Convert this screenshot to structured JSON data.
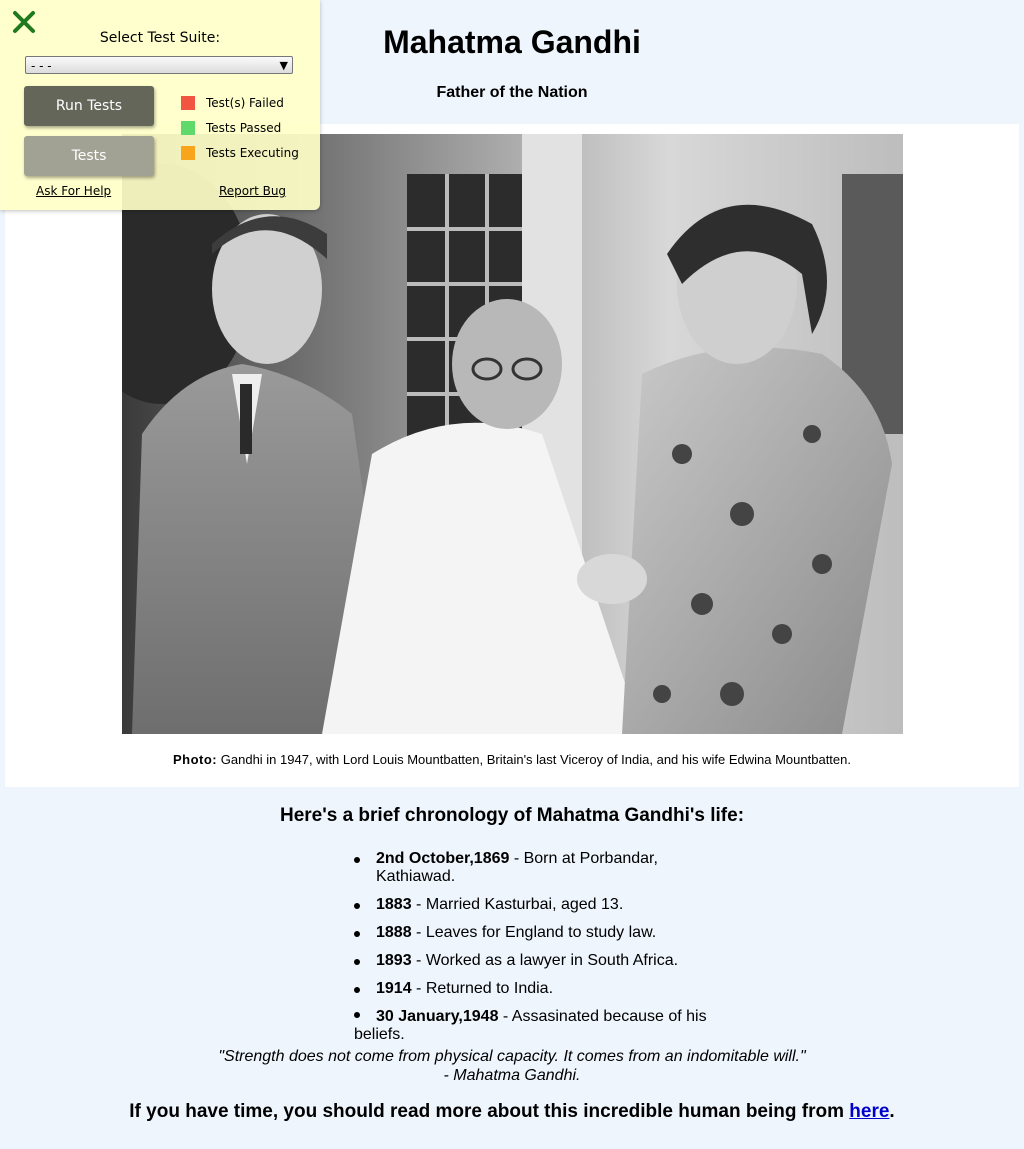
{
  "page": {
    "title": "Mahatma Gandhi",
    "subtitle": "Father of the Nation",
    "photo": {
      "caption_label": "Photo:",
      "caption_text": "Gandhi in 1947, with Lord Louis Mountbatten, Britain's last Viceroy of India, and his wife Edwina Mountbatten."
    },
    "chronology_heading": "Here's a brief chronology of Mahatma Gandhi's life:",
    "timeline": [
      {
        "date": "2nd October,1869",
        "event": " - Born at Porbandar, Kathiawad."
      },
      {
        "date": "1883",
        "event": " - Married Kasturbai, aged 13."
      },
      {
        "date": "1888",
        "event": " - Leaves for England to study law."
      },
      {
        "date": "1893",
        "event": " - Worked as a lawyer in South Africa."
      },
      {
        "date": "1914",
        "event": " - Returned to India."
      },
      {
        "date": "30 January,1948",
        "event": " - Assasinated because of his",
        "event_cont": "beliefs."
      }
    ],
    "quote": {
      "text": "\"Strength does not come from physical capacity. It comes from an indomitable will.\"",
      "author": "- Mahatma Gandhi."
    },
    "closing": {
      "text": "If you have time, you should read more about this incredible human being from ",
      "link_text": "here",
      "end": "."
    }
  },
  "test_panel": {
    "close_icon": "close-x-icon",
    "suite_label": "Select Test Suite:",
    "suite_selected": "- - -",
    "run_button": "Run Tests",
    "tests_button": "Tests",
    "legend": [
      {
        "label": "Test(s) Failed",
        "color": "#f25442"
      },
      {
        "label": "Tests Passed",
        "color": "#5fd96a"
      },
      {
        "label": "Tests Executing",
        "color": "#f8a51c"
      }
    ],
    "ask_help": "Ask For Help",
    "report_bug": "Report Bug"
  },
  "colors": {
    "background": "#eef5fd",
    "panel": "#ffffc8",
    "link": "#0000cc"
  }
}
